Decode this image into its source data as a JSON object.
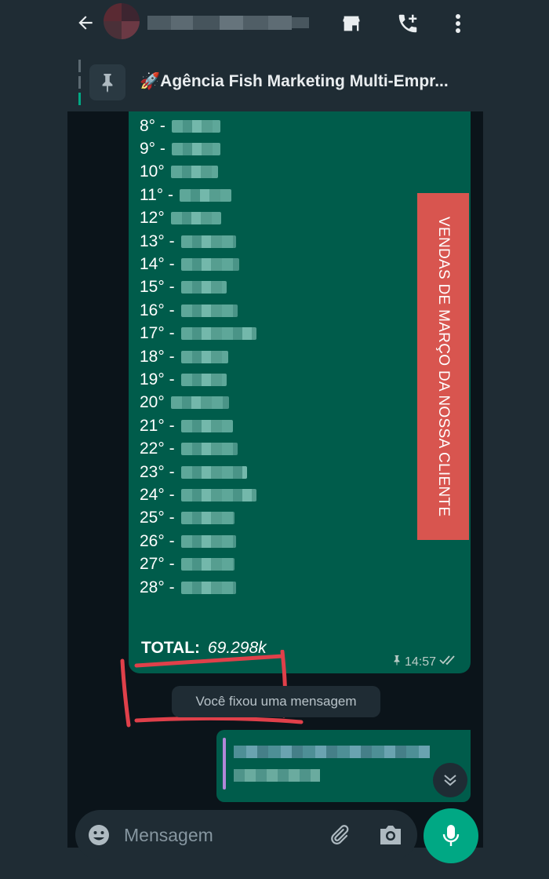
{
  "header": {
    "icons": [
      "back-arrow-icon",
      "store-icon",
      "add-call-icon",
      "more-vert-icon"
    ]
  },
  "pinned": {
    "text": "🚀Agência Fish Marketing Multi-Empr..."
  },
  "message": {
    "ranks": [
      "8° -",
      "9° -",
      "10°",
      "11° -",
      "12°",
      "13° -",
      "14° -",
      "15° -",
      "16° -",
      "17° -",
      "18° -",
      "19° -",
      "20°",
      "21° -",
      "22° -",
      "23° -",
      "24° -",
      "25° -",
      "26° -",
      "27° -",
      "28° -"
    ],
    "banner": "VENDAS DE MARÇO DA NOSSA CLIENTE",
    "total_label": "TOTAL:",
    "total_value": "69.298k",
    "time": "14:57"
  },
  "system_message": "Você fixou uma mensagem",
  "composer": {
    "placeholder": "Mensagem"
  },
  "colors": {
    "bubble": "#005c4b",
    "banner": "#d8554f",
    "accent": "#00a884",
    "annotation": "#e0404a"
  }
}
